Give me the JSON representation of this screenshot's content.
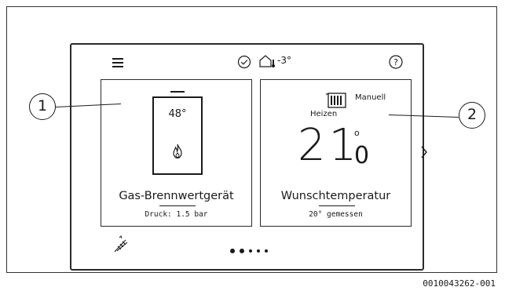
{
  "topbar": {
    "outdoor_temp": "-3°"
  },
  "tiles": {
    "boiler": {
      "temperature": "48°",
      "title": "Gas-Brennwertgerät",
      "subtitle": "Druck: 1.5 bar"
    },
    "thermostat": {
      "mode": "Manuell",
      "state": "Heizen",
      "temp_integer": "21",
      "temp_unit": "o",
      "temp_decimal": "0",
      "title": "Wunschtemperatur",
      "subtitle": "20° gemessen"
    }
  },
  "pagination": {
    "current": 1,
    "total": 5
  },
  "callouts": [
    "1",
    "2"
  ],
  "figure_id": "0010043262-001"
}
